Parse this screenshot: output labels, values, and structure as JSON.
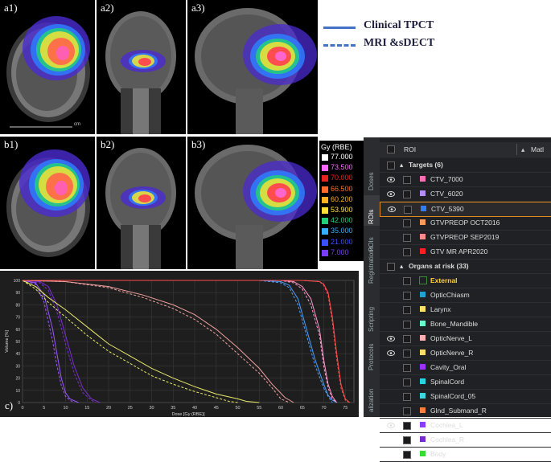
{
  "legend": {
    "items": [
      {
        "label": "Clinical TPCT",
        "style": "solid"
      },
      {
        "label": "MRI &sDECT",
        "style": "dashed"
      }
    ],
    "color": "#4472c4"
  },
  "panels": {
    "a1": "a1)",
    "a2": "a2)",
    "a3": "a3)",
    "b1": "b1)",
    "b2": "b2)",
    "b3": "b3)",
    "c": "c)",
    "scale_text": "cm"
  },
  "colorbar": {
    "title": "Gy (RBE)",
    "ticks": [
      {
        "label": "77.000",
        "color": "#ffffff"
      },
      {
        "label": "73.500",
        "color": "#ff66ff"
      },
      {
        "label": "70.000",
        "color": "#e8231f"
      },
      {
        "label": "66.500",
        "color": "#ff6a2a"
      },
      {
        "label": "60.200",
        "color": "#ffb021"
      },
      {
        "label": "53.900",
        "color": "#ffe033"
      },
      {
        "label": "42.000",
        "color": "#22d07a"
      },
      {
        "label": "35.000",
        "color": "#33b0ff"
      },
      {
        "label": "21.000",
        "color": "#3a4fff"
      },
      {
        "label": "7.000",
        "color": "#7a3dff"
      }
    ]
  },
  "chart_data": {
    "type": "line",
    "xlabel": "Dose [Gy (RBE)]",
    "ylabel": "Volume [%]",
    "xlim": [
      0,
      77
    ],
    "ylim": [
      0,
      100
    ],
    "x_ticks": [
      0,
      5,
      10,
      15,
      20,
      25,
      30,
      35,
      40,
      45,
      50,
      55,
      60,
      65,
      70,
      75
    ],
    "y_ticks": [
      0,
      10,
      20,
      30,
      40,
      50,
      60,
      70,
      80,
      90,
      100
    ],
    "series": [
      {
        "color": "#9b59ff",
        "style": "solid",
        "points": [
          [
            0,
            100
          ],
          [
            3,
            98
          ],
          [
            5,
            88
          ],
          [
            7,
            60
          ],
          [
            8,
            40
          ],
          [
            9,
            20
          ],
          [
            10,
            8
          ],
          [
            11,
            3
          ],
          [
            13,
            0
          ]
        ]
      },
      {
        "color": "#9b59ff",
        "style": "dashed",
        "points": [
          [
            0,
            100
          ],
          [
            3,
            97
          ],
          [
            5,
            82
          ],
          [
            7,
            50
          ],
          [
            8,
            30
          ],
          [
            9,
            14
          ],
          [
            10,
            5
          ],
          [
            11,
            2
          ],
          [
            12,
            0
          ]
        ]
      },
      {
        "color": "#7b2fd0",
        "style": "solid",
        "points": [
          [
            0,
            100
          ],
          [
            4,
            99
          ],
          [
            6,
            95
          ],
          [
            8,
            80
          ],
          [
            10,
            55
          ],
          [
            12,
            30
          ],
          [
            14,
            12
          ],
          [
            16,
            3
          ],
          [
            18,
            0
          ]
        ]
      },
      {
        "color": "#7b2fd0",
        "style": "dashed",
        "points": [
          [
            0,
            100
          ],
          [
            4,
            98
          ],
          [
            6,
            92
          ],
          [
            8,
            74
          ],
          [
            10,
            48
          ],
          [
            12,
            24
          ],
          [
            14,
            8
          ],
          [
            16,
            2
          ],
          [
            17,
            0
          ]
        ]
      },
      {
        "color": "#e8e86a",
        "style": "solid",
        "points": [
          [
            0,
            100
          ],
          [
            3,
            95
          ],
          [
            6,
            86
          ],
          [
            10,
            76
          ],
          [
            15,
            62
          ],
          [
            20,
            48
          ],
          [
            25,
            38
          ],
          [
            30,
            28
          ],
          [
            35,
            20
          ],
          [
            40,
            13
          ],
          [
            45,
            7
          ],
          [
            50,
            3
          ],
          [
            52,
            1
          ],
          [
            55,
            0
          ]
        ]
      },
      {
        "color": "#e8e86a",
        "style": "dashed",
        "points": [
          [
            0,
            100
          ],
          [
            3,
            93
          ],
          [
            6,
            82
          ],
          [
            10,
            70
          ],
          [
            15,
            55
          ],
          [
            20,
            42
          ],
          [
            25,
            32
          ],
          [
            30,
            22
          ],
          [
            35,
            15
          ],
          [
            40,
            9
          ],
          [
            45,
            4
          ],
          [
            48,
            1
          ],
          [
            50,
            0
          ]
        ]
      },
      {
        "color": "#f0a0a0",
        "style": "solid",
        "points": [
          [
            0,
            100
          ],
          [
            10,
            99
          ],
          [
            20,
            95
          ],
          [
            28,
            88
          ],
          [
            35,
            80
          ],
          [
            40,
            72
          ],
          [
            45,
            60
          ],
          [
            50,
            45
          ],
          [
            55,
            28
          ],
          [
            58,
            15
          ],
          [
            61,
            4
          ],
          [
            63,
            0
          ]
        ]
      },
      {
        "color": "#f0a0a0",
        "style": "dashed",
        "points": [
          [
            0,
            100
          ],
          [
            10,
            99
          ],
          [
            20,
            94
          ],
          [
            28,
            86
          ],
          [
            35,
            77
          ],
          [
            40,
            68
          ],
          [
            45,
            56
          ],
          [
            50,
            40
          ],
          [
            55,
            24
          ],
          [
            58,
            12
          ],
          [
            60,
            3
          ],
          [
            62,
            0
          ]
        ]
      },
      {
        "color": "#4aa0ff",
        "style": "solid",
        "points": [
          [
            0,
            100
          ],
          [
            55,
            100
          ],
          [
            60,
            99
          ],
          [
            62,
            96
          ],
          [
            64,
            85
          ],
          [
            66,
            60
          ],
          [
            68,
            35
          ],
          [
            70,
            15
          ],
          [
            71,
            6
          ],
          [
            72,
            2
          ],
          [
            73,
            0
          ]
        ]
      },
      {
        "color": "#4aa0ff",
        "style": "dashed",
        "points": [
          [
            0,
            100
          ],
          [
            55,
            100
          ],
          [
            60,
            98
          ],
          [
            62,
            94
          ],
          [
            64,
            80
          ],
          [
            66,
            55
          ],
          [
            68,
            30
          ],
          [
            70,
            12
          ],
          [
            71,
            5
          ],
          [
            72,
            0
          ]
        ]
      },
      {
        "color": "#ff99cc",
        "style": "solid",
        "points": [
          [
            0,
            100
          ],
          [
            60,
            100
          ],
          [
            63,
            99
          ],
          [
            65,
            95
          ],
          [
            67,
            85
          ],
          [
            69,
            60
          ],
          [
            70,
            35
          ],
          [
            71,
            15
          ],
          [
            72,
            5
          ],
          [
            73,
            0
          ]
        ]
      },
      {
        "color": "#ff99cc",
        "style": "dashed",
        "points": [
          [
            0,
            100
          ],
          [
            60,
            100
          ],
          [
            63,
            98
          ],
          [
            65,
            93
          ],
          [
            67,
            80
          ],
          [
            69,
            55
          ],
          [
            70,
            30
          ],
          [
            71,
            12
          ],
          [
            72,
            3
          ],
          [
            73,
            0
          ]
        ]
      },
      {
        "color": "#ff4d4d",
        "style": "solid",
        "points": [
          [
            0,
            100
          ],
          [
            65,
            100
          ],
          [
            69,
            99
          ],
          [
            70,
            97
          ],
          [
            71,
            90
          ],
          [
            72,
            70
          ],
          [
            73,
            40
          ],
          [
            74,
            15
          ],
          [
            75,
            3
          ],
          [
            76,
            0
          ]
        ]
      },
      {
        "color": "#ff4d4d",
        "style": "dashed",
        "points": [
          [
            0,
            100
          ],
          [
            65,
            100
          ],
          [
            69,
            99
          ],
          [
            70,
            96
          ],
          [
            71,
            88
          ],
          [
            72,
            66
          ],
          [
            73,
            36
          ],
          [
            74,
            12
          ],
          [
            75,
            2
          ],
          [
            76,
            0
          ]
        ]
      }
    ]
  },
  "roi_panel": {
    "header": "ROI",
    "header_right": "Matl",
    "tabs": [
      "Doses",
      "ROIs",
      "POIs",
      "Registrations",
      "Scripting",
      "Protocols",
      "alization"
    ],
    "active_tab": "ROIs",
    "targets_header": "Targets (6)",
    "targets": [
      {
        "name": "CTV_7000",
        "color": "#ff6eb4",
        "visible": true
      },
      {
        "name": "CTV_6020",
        "color": "#b58cff",
        "visible": true
      },
      {
        "name": "CTV_5390",
        "color": "#2f7cff",
        "visible": true,
        "selected": true
      },
      {
        "name": "GTVPREOP OCT2016",
        "color": "#ff9b5a",
        "visible": false
      },
      {
        "name": "GTVPREOP SEP2019",
        "color": "#ff8a8a",
        "visible": false
      },
      {
        "name": "GTV MR APR2020",
        "color": "#ff2020",
        "visible": false
      }
    ],
    "oar_header": "Organs at risk (33)",
    "oars": [
      {
        "name": "External",
        "color": "#3a8a3a",
        "visible": false,
        "highlight": true
      },
      {
        "name": "OpticChiasm",
        "color": "#1fa3d6",
        "visible": false
      },
      {
        "name": "Larynx",
        "color": "#ffe066",
        "visible": false
      },
      {
        "name": "Bone_Mandible",
        "color": "#66ffcc",
        "visible": false
      },
      {
        "name": "OpticNerve_L",
        "color": "#ffb0b0",
        "visible": true
      },
      {
        "name": "OpticNerve_R",
        "color": "#ffdd66",
        "visible": true
      },
      {
        "name": "Cavity_Oral",
        "color": "#9b30ff",
        "visible": false
      },
      {
        "name": "SpinalCord",
        "color": "#22d8e8",
        "visible": false
      },
      {
        "name": "SpinalCord_05",
        "color": "#3ad8e0",
        "visible": false
      },
      {
        "name": "Glnd_Submand_R",
        "color": "#ff7f3a",
        "visible": false
      },
      {
        "name": "Cochlea_L",
        "color": "#8c3bff",
        "visible": true
      },
      {
        "name": "Cochlea_R",
        "color": "#7a2bd0",
        "visible": false
      },
      {
        "name": "Body",
        "color": "#33dd33",
        "visible": false
      }
    ]
  }
}
